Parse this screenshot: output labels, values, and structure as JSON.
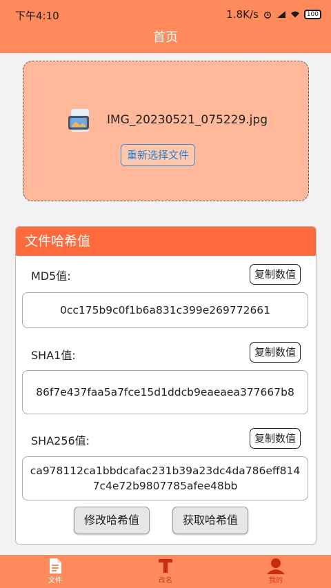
{
  "status_bar": {
    "time": "下午4:10",
    "net_speed": "1.8K/s",
    "battery": "100"
  },
  "header": {
    "title": "首页"
  },
  "file_picker": {
    "file_name": "IMG_20230521_075229.jpg",
    "reselect_label": "重新选择文件"
  },
  "hash_panel": {
    "title": "文件哈希值",
    "copy_label": "复制数值",
    "md5": {
      "label": "MD5值:",
      "value": "0cc175b9c0f1b6a831c399e269772661"
    },
    "sha1": {
      "label": "SHA1值:",
      "value": "86f7e437faa5a7fce15d1ddcb9eaeaea377667b8"
    },
    "sha256": {
      "label": "SHA256值:",
      "value": "ca978112ca1bbdcafac231b39a23dc4da786eff8147c4e72b9807785afee48bb"
    },
    "modify_label": "修改哈希值",
    "get_label": "获取哈希值"
  },
  "tab_bar": {
    "tabs": [
      {
        "label": "文件",
        "icon": "document-icon",
        "active": true
      },
      {
        "label": "改名",
        "icon": "text-t-icon",
        "active": false
      },
      {
        "label": "我的",
        "icon": "user-icon",
        "active": false
      }
    ]
  },
  "colors": {
    "accent": "#ff8a5c",
    "panel_header": "#ff6a3d",
    "picker_bg": "#ffb899",
    "link_blue": "#2a7fd0"
  }
}
